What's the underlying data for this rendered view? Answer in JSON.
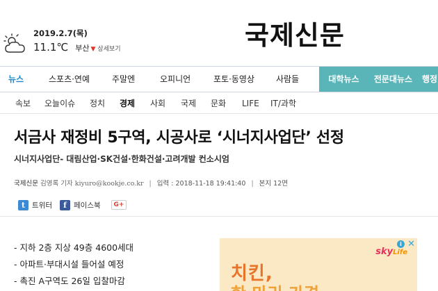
{
  "weather": {
    "date": "2019.2.7(목)",
    "temp": "11.1℃",
    "city": "부산",
    "detail_label": "상세보기"
  },
  "logo": "국제신문",
  "gnb": [
    "뉴스",
    "스포츠·연예",
    "주말엔",
    "오피니언",
    "포토·동영상",
    "사람들",
    "대학뉴스",
    "전문대뉴스",
    "행정"
  ],
  "lnb": [
    "속보",
    "오늘이슈",
    "정치",
    "경제",
    "사회",
    "국제",
    "문화",
    "LIFE",
    "IT/과학"
  ],
  "article": {
    "headline": "서금사 재정비 5구역, 시공사로 ‘시너지사업단’ 선정",
    "subhead": "시너지사업단- 대림산업·SK건설·한화건설·고려개발 컨소시엄",
    "source": "국제신문",
    "reporter": "김영록 기자 kiyuro@kookje.co.kr",
    "input_time": "입력 : 2018-11-18 19:41:40",
    "edition": "본지 12면",
    "summary": [
      "- 지하 2층 지상 49층 4600세대",
      "- 아파트·부대시설 들어설 예정",
      "- 촉진 A구역도 26일 입찰마감"
    ]
  },
  "share": {
    "twitter_label": "트위터",
    "facebook_label": "페이스북",
    "gplus_label": "G+"
  },
  "ad": {
    "brand_sky": "sky",
    "brand_life": "Life",
    "info": "i",
    "close": "✕",
    "line1": "치킨,",
    "line2": "한 마리 가격"
  }
}
